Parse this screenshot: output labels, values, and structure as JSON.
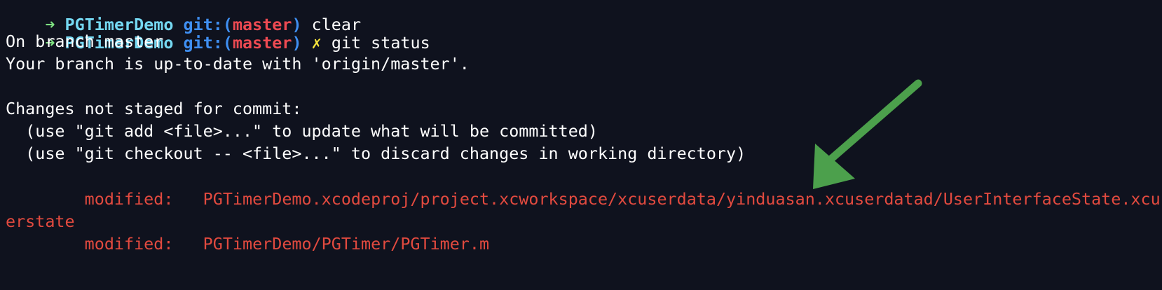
{
  "prev_prompt": {
    "arrow": "➜",
    "directory": "PGTimerDemo",
    "git_prefix": "git:(",
    "branch": "master",
    "git_suffix": ")",
    "command": "clear"
  },
  "prompt": {
    "arrow": "➜",
    "directory": "PGTimerDemo",
    "git_prefix": "git:(",
    "branch": "master",
    "git_suffix": ")",
    "dirty": "✗",
    "command": "git status"
  },
  "output": {
    "line1": "On branch master",
    "line2": "Your branch is up-to-date with 'origin/master'.",
    "line3": "Changes not staged for commit:",
    "line4": "  (use \"git add <file>...\" to update what will be committed)",
    "line5": "  (use \"git checkout -- <file>...\" to discard changes in working directory)"
  },
  "changes": [
    {
      "status": "modified:",
      "path": "PGTimerDemo.xcodeproj/project.xcworkspace/xcuserdata/yinduasan.xcuserdatad/UserInterfaceState.xcus",
      "path_wrap": "erstate"
    },
    {
      "status": "modified:",
      "path": "PGTimerDemo/PGTimer/PGTimer.m"
    }
  ],
  "colors": {
    "background": "#0f121e",
    "text": "#ffffff",
    "prompt_arrow": "#7ee081",
    "prompt_dir": "#75d8f2",
    "git_label": "#3f8ff2",
    "branch": "#ef4a52",
    "dirty_marker": "#f6e43c",
    "modified": "#e24a3f",
    "annotation_arrow": "#4ca04c"
  },
  "icons": {
    "annotation": "green-pointer-arrow"
  }
}
